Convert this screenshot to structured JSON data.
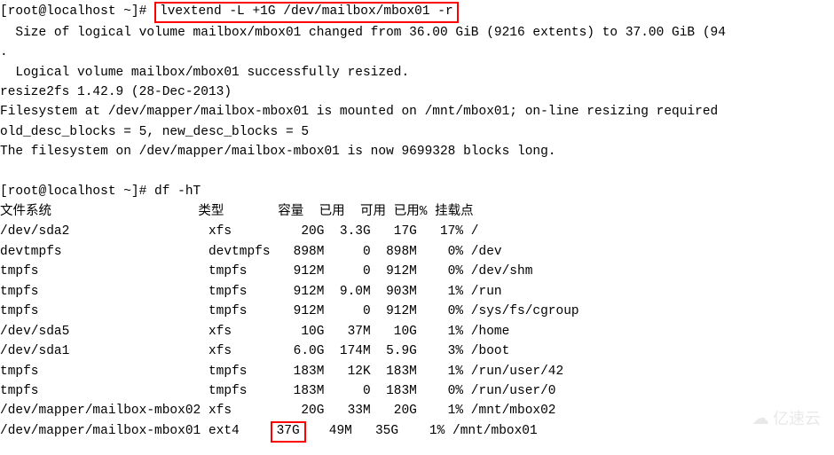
{
  "prompt1": {
    "prefix": "[root@localhost ~]# ",
    "command": "lvextend -L +1G /dev/mailbox/mbox01 -r"
  },
  "output1": {
    "l1": "  Size of logical volume mailbox/mbox01 changed from 36.00 GiB (9216 extents) to 37.00 GiB (94",
    "l2": ".",
    "l3": "  Logical volume mailbox/mbox01 successfully resized.",
    "l4": "resize2fs 1.42.9 (28-Dec-2013)",
    "l5": "Filesystem at /dev/mapper/mailbox-mbox01 is mounted on /mnt/mbox01; on-line resizing required",
    "l6": "old_desc_blocks = 5, new_desc_blocks = 5",
    "l7": "The filesystem on /dev/mapper/mailbox-mbox01 is now 9699328 blocks long."
  },
  "prompt2": {
    "prefix": "[root@localhost ~]# ",
    "command": "df -hT"
  },
  "df": {
    "headers": {
      "fs": "文件系统",
      "type": "类型",
      "size": "容量",
      "used": "已用",
      "avail": "可用",
      "usep": "已用%",
      "mount": "挂载点"
    },
    "rows": [
      {
        "fs": "/dev/sda2",
        "type": "xfs",
        "size": "20G",
        "used": "3.3G",
        "avail": "17G",
        "usep": "17%",
        "mount": "/"
      },
      {
        "fs": "devtmpfs",
        "type": "devtmpfs",
        "size": "898M",
        "used": "0",
        "avail": "898M",
        "usep": "0%",
        "mount": "/dev"
      },
      {
        "fs": "tmpfs",
        "type": "tmpfs",
        "size": "912M",
        "used": "0",
        "avail": "912M",
        "usep": "0%",
        "mount": "/dev/shm"
      },
      {
        "fs": "tmpfs",
        "type": "tmpfs",
        "size": "912M",
        "used": "9.0M",
        "avail": "903M",
        "usep": "1%",
        "mount": "/run"
      },
      {
        "fs": "tmpfs",
        "type": "tmpfs",
        "size": "912M",
        "used": "0",
        "avail": "912M",
        "usep": "0%",
        "mount": "/sys/fs/cgroup"
      },
      {
        "fs": "/dev/sda5",
        "type": "xfs",
        "size": "10G",
        "used": "37M",
        "avail": "10G",
        "usep": "1%",
        "mount": "/home"
      },
      {
        "fs": "/dev/sda1",
        "type": "xfs",
        "size": "6.0G",
        "used": "174M",
        "avail": "5.9G",
        "usep": "3%",
        "mount": "/boot"
      },
      {
        "fs": "tmpfs",
        "type": "tmpfs",
        "size": "183M",
        "used": "12K",
        "avail": "183M",
        "usep": "1%",
        "mount": "/run/user/42"
      },
      {
        "fs": "tmpfs",
        "type": "tmpfs",
        "size": "183M",
        "used": "0",
        "avail": "183M",
        "usep": "0%",
        "mount": "/run/user/0"
      },
      {
        "fs": "/dev/mapper/mailbox-mbox02",
        "type": "xfs",
        "size": "20G",
        "used": "33M",
        "avail": "20G",
        "usep": "1%",
        "mount": "/mnt/mbox02"
      },
      {
        "fs": "/dev/mapper/mailbox-mbox01",
        "type": "ext4",
        "size": "37G",
        "used": "49M",
        "avail": "35G",
        "usep": "1%",
        "mount": "/mnt/mbox01"
      }
    ]
  },
  "watermark": "亿速云"
}
